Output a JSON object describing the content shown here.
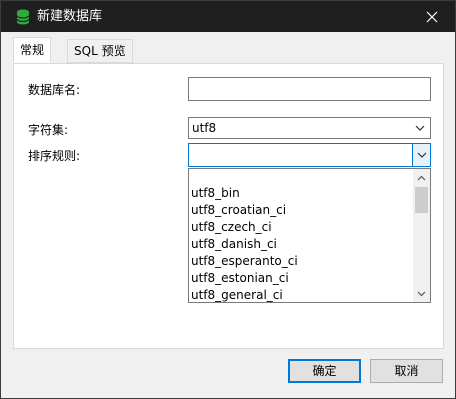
{
  "window": {
    "title": "新建数据库"
  },
  "tabs": [
    {
      "label": "常规"
    },
    {
      "label": "SQL 预览"
    }
  ],
  "form": {
    "db_name_label": "数据库名:",
    "db_name_value": "",
    "charset_label": "字符集:",
    "charset_value": "utf8",
    "collation_label": "排序规则:",
    "collation_value": ""
  },
  "dropdown": {
    "options": [
      "utf8_bin",
      "utf8_croatian_ci",
      "utf8_czech_ci",
      "utf8_danish_ci",
      "utf8_esperanto_ci",
      "utf8_estonian_ci",
      "utf8_general_ci"
    ]
  },
  "buttons": {
    "ok": "确定",
    "cancel": "取消"
  },
  "colors": {
    "titlebar": "#1f1f1f",
    "accent": "#0078d7",
    "db_icon": "#2eaa3e"
  }
}
